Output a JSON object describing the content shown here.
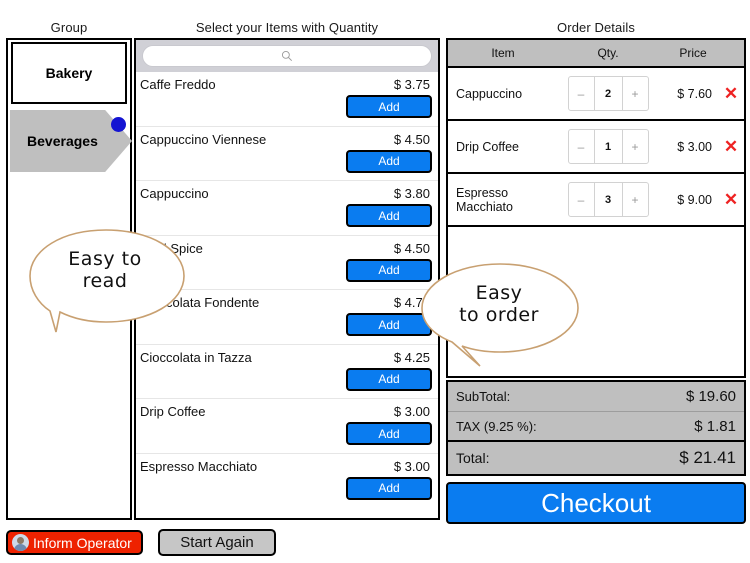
{
  "headers": {
    "group": "Group",
    "items": "Select your Items with Quantity",
    "order": "Order Details"
  },
  "groups": [
    {
      "label": "Bakery",
      "selected": false
    },
    {
      "label": "Beverages",
      "selected": true
    }
  ],
  "search": {
    "value": "",
    "placeholder": "",
    "icon": "search-icon"
  },
  "menu": {
    "add_label": "Add",
    "items": [
      {
        "name": "Caffe Freddo",
        "price": "$ 3.75"
      },
      {
        "name": "Cappuccino Viennese",
        "price": "$ 4.50"
      },
      {
        "name": "Cappuccino",
        "price": "$ 3.80"
      },
      {
        "name": "Chai Spice",
        "price": "$ 4.50"
      },
      {
        "name": "Cioccolata Fondente",
        "price": "$ 4.75"
      },
      {
        "name": "Cioccolata in Tazza",
        "price": "$ 4.25"
      },
      {
        "name": "Drip Coffee",
        "price": "$ 3.00"
      },
      {
        "name": "Espresso Macchiato",
        "price": "$ 3.00"
      }
    ]
  },
  "order": {
    "columns": {
      "item": "Item",
      "qty": "Qty.",
      "price": "Price"
    },
    "minus": "–",
    "plus": "+",
    "remove": "✕",
    "rows": [
      {
        "name": "Cappuccino",
        "qty": "2",
        "price": "$ 7.60"
      },
      {
        "name": "Drip Coffee",
        "qty": "1",
        "price": "$ 3.00"
      },
      {
        "name": "Espresso Macchiato",
        "qty": "3",
        "price": "$ 9.00"
      }
    ],
    "totals": {
      "subtotal_label": "SubTotal:",
      "subtotal_value": "$ 19.60",
      "tax_label": "TAX (9.25 %):",
      "tax_value": "$ 1.81",
      "total_label": "Total:",
      "total_value": "$ 21.41"
    },
    "checkout_label": "Checkout"
  },
  "footer": {
    "inform_label": "Inform Operator",
    "start_label": "Start Again"
  },
  "annotations": {
    "read_line1": "Easy to",
    "read_line2": "read",
    "order_line1": "Easy",
    "order_line2": "to order"
  },
  "colors": {
    "accent_blue": "#0a7cf0",
    "alert_red": "#ee2200",
    "panel_gray": "#bfbfbf",
    "dot_blue": "#1414d2",
    "bubble_outline": "#c8a071"
  }
}
